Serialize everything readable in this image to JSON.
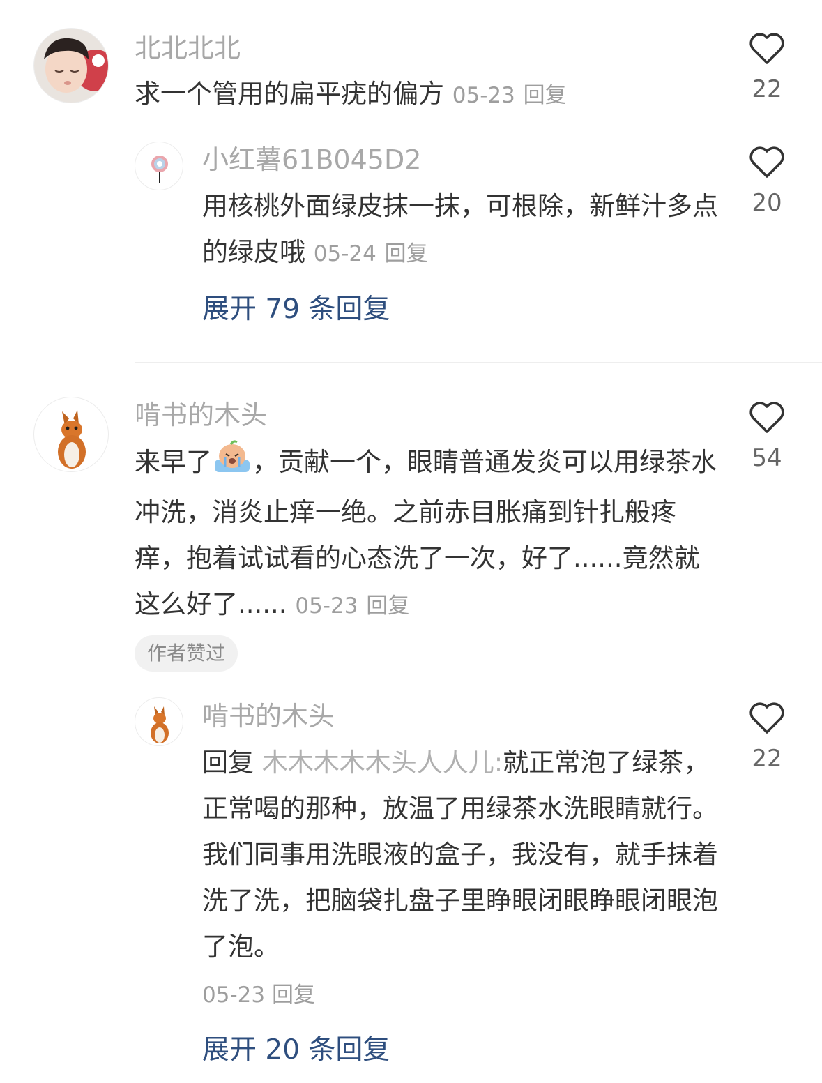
{
  "comments": [
    {
      "user": "北北北北",
      "text": "求一个管用的扁平疣的偏方",
      "date": "05-23",
      "reply_label": "回复",
      "likes": "22",
      "replies": [
        {
          "user": "小红薯61B045D2",
          "text": "用核桃外面绿皮抹一抹，可根除，新鲜汁多点的绿皮哦",
          "date": "05-24",
          "reply_label": "回复",
          "likes": "20"
        }
      ],
      "expand": "展开 79 条回复"
    },
    {
      "user": "啃书的木头",
      "text_part1": "来早了",
      "text_part2": "，贡献一个，眼睛普通发炎可以用绿茶水冲洗，消炎止痒一绝。之前赤目胀痛到针扎般疼痒，抱着试试看的心态洗了一次，好了......竟然就这么好了......",
      "date": "05-23",
      "reply_label": "回复",
      "likes": "54",
      "badge": "作者赞过",
      "replies": [
        {
          "user": "啃书的木头",
          "reply_prefix": "回复",
          "reply_to": "木木木木木头人人儿:",
          "text": "就正常泡了绿茶，正常喝的那种，放温了用绿茶水洗眼睛就行。我们同事用洗眼液的盒子，我没有，就手抹着洗了洗，把脑袋扎盘子里睁眼闭眼睁眼闭眼泡了泡。",
          "date": "05-23",
          "reply_label": "回复",
          "likes": "22"
        }
      ],
      "expand": "展开 20 条回复"
    }
  ]
}
